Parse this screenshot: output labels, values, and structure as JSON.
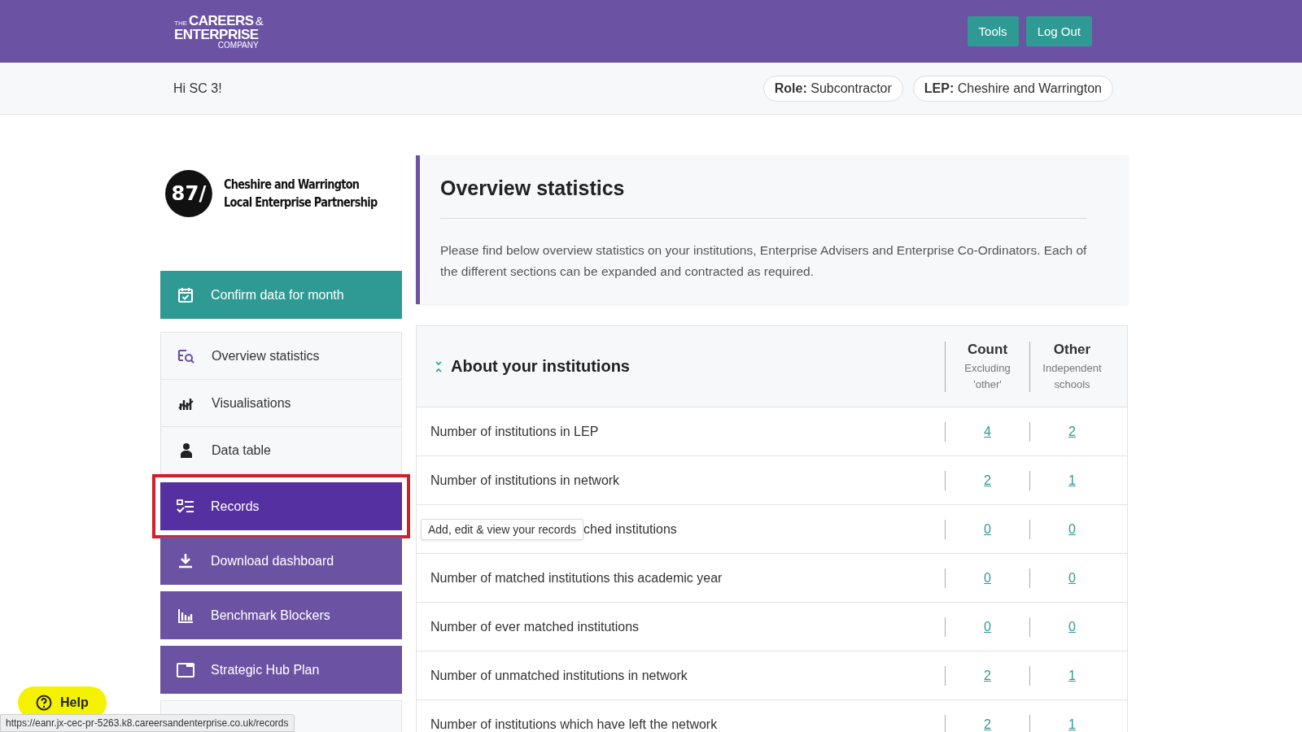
{
  "header": {
    "logo": {
      "small": "THE",
      "line1": "CAREERS",
      "amp": "&",
      "line2": "ENTERPRISE",
      "line3": "COMPANY"
    },
    "buttons": [
      "Tools",
      "Log Out"
    ]
  },
  "subheader": {
    "greeting": "Hi SC 3!",
    "pills": [
      {
        "label": "Role:",
        "value": "Subcontractor"
      },
      {
        "label": "LEP:",
        "value": "Cheshire and Warrington"
      }
    ]
  },
  "lep": {
    "badge": "87/",
    "name_lines": [
      "Cheshire and Warrington",
      "Local Enterprise Partnership"
    ]
  },
  "sidebar": {
    "items": [
      {
        "label": "Confirm data for month",
        "kind": "action",
        "selected": false
      },
      {
        "label": "Overview statistics",
        "kind": "nav",
        "selected": false
      },
      {
        "label": "Visualisations",
        "kind": "nav",
        "selected": false
      },
      {
        "label": "Data table",
        "kind": "nav",
        "selected": false
      },
      {
        "label": "Records",
        "kind": "tool",
        "selected": true
      },
      {
        "label": "Download dashboard",
        "kind": "tool",
        "selected": false
      },
      {
        "label": "Benchmark Blockers",
        "kind": "tool",
        "selected": false
      },
      {
        "label": "Strategic Hub Plan",
        "kind": "tool",
        "selected": false
      }
    ]
  },
  "intro": {
    "title": "Overview statistics",
    "text": "Please find below overview statistics on your institutions, Enterprise Advisers and Enterprise Co-Ordinators. Each of the different sections can be expanded and contracted as required."
  },
  "section": {
    "title": "About your institutions",
    "expanded": true,
    "columns": [
      {
        "title": "Count",
        "sub": "Excluding 'other'"
      },
      {
        "title": "Other",
        "sub": "Independent schools"
      }
    ],
    "rows": [
      {
        "label": "Number of institutions in LEP",
        "values": [
          "4",
          "2"
        ]
      },
      {
        "label": "Number of institutions in network",
        "values": [
          "2",
          "1"
        ]
      },
      {
        "label": "ched institutions",
        "tooltip": "Add, edit & view your records",
        "values": [
          "0",
          "0"
        ]
      },
      {
        "label": "Number of matched institutions this academic year",
        "values": [
          "0",
          "0"
        ]
      },
      {
        "label": "Number of ever matched institutions",
        "values": [
          "0",
          "0"
        ]
      },
      {
        "label": "Number of unmatched institutions in network",
        "values": [
          "2",
          "1"
        ]
      },
      {
        "label": "Number of institutions which have left the network",
        "values": [
          "2",
          "1"
        ]
      }
    ]
  },
  "help": {
    "label": "Help"
  },
  "status_url": "https://eanr.jx-cec-pr-5263.k8.careersandenterprise.co.uk/records"
}
